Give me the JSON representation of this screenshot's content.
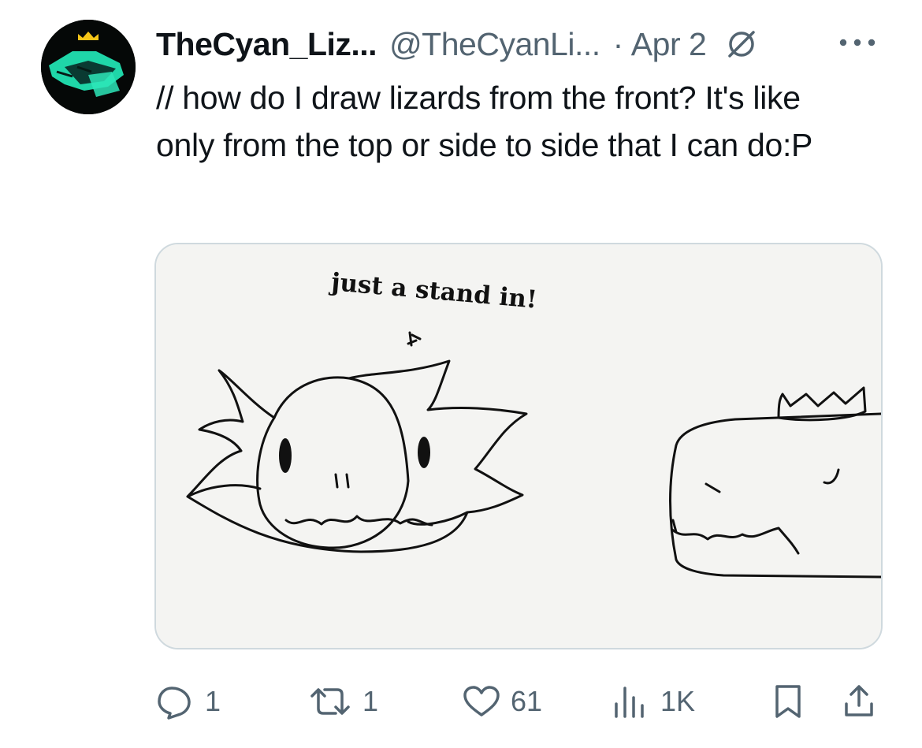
{
  "tweet": {
    "author": {
      "display_name": "TheCyan_Liz...",
      "handle": "@TheCyanLi...",
      "avatar_icon": "crowned-lizard-avatar"
    },
    "separator": "·",
    "date": "Apr 2",
    "edited_icon": "edited-circle-slash-icon",
    "more_icon": "more-options-icon",
    "text": "// how do I draw lizards from the front? It's like only from the top or side to side that I can do:P",
    "media": {
      "caption": "just a stand in!",
      "description_icons": [
        "lizard-front-sketch",
        "lizard-side-sketch-with-crown"
      ]
    },
    "actions": {
      "replies": "1",
      "reposts": "1",
      "likes": "61",
      "views": "1K"
    },
    "colors": {
      "text": "#0f1419",
      "secondary": "#536471",
      "border": "#cfd9de",
      "avatar_accent": "#2ee6b8",
      "crown": "#f5c518"
    }
  }
}
